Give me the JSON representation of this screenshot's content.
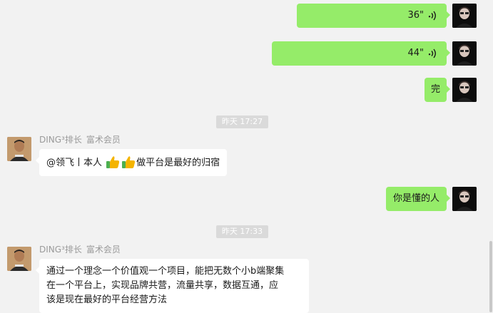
{
  "messages": [
    {
      "kind": "voice",
      "side": "self",
      "duration": "36\""
    },
    {
      "kind": "voice",
      "side": "self",
      "duration": "44\""
    },
    {
      "kind": "text",
      "side": "self",
      "text": "完"
    },
    {
      "kind": "time",
      "text": "昨天 17:27"
    },
    {
      "kind": "text",
      "side": "peer",
      "sender_name": "DING³排长",
      "sender_role": "富术会员",
      "text_before": "@领飞丨本人 ",
      "text_after": "做平台是最好的归宿"
    },
    {
      "kind": "text",
      "side": "self",
      "text": "你是懂的人"
    },
    {
      "kind": "time",
      "text": "昨天 17:33"
    },
    {
      "kind": "text",
      "side": "peer",
      "sender_name": "DING³排长",
      "sender_role": "富术会员",
      "lines": [
        "通过一个理念一个价值观一个项目，能把无数个小b端聚集",
        "在一个平台上，实现品牌共营，流量共享，数据互通，应",
        "该是现在最好的平台经营方法"
      ]
    }
  ],
  "icons": {
    "voice": "voice-wave-icon",
    "thumb": "thumbs-up-emoji"
  },
  "colors": {
    "self_bubble": "#95ec69",
    "peer_bubble": "#ffffff",
    "background": "#f2f2f2"
  }
}
